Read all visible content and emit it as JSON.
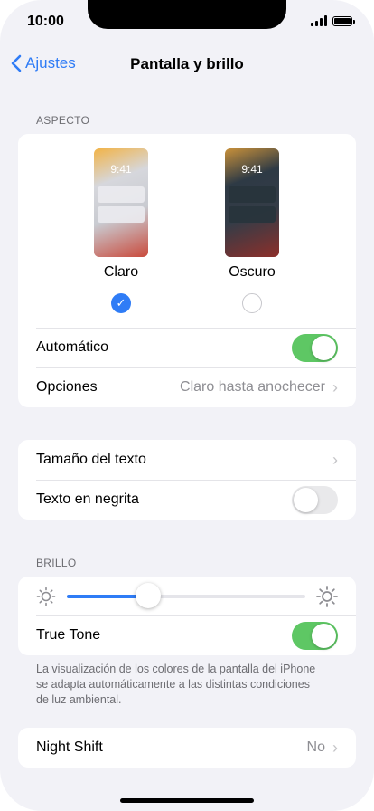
{
  "status": {
    "time": "10:00"
  },
  "nav": {
    "back_label": "Ajustes",
    "title": "Pantalla y brillo"
  },
  "appearance": {
    "header": "ASPECTO",
    "preview_time": "9:41",
    "light_label": "Claro",
    "dark_label": "Oscuro",
    "selected": "Claro"
  },
  "appearance_rows": {
    "automatic_label": "Automático",
    "automatic_on": true,
    "options_label": "Opciones",
    "options_value": "Claro hasta anochecer"
  },
  "text_rows": {
    "text_size_label": "Tamaño del texto",
    "bold_label": "Texto en negrita",
    "bold_on": false
  },
  "brightness": {
    "header": "BRILLO",
    "level": 0.34,
    "true_tone_label": "True Tone",
    "true_tone_on": true,
    "note": "La visualización de los colores de la pantalla del iPhone se adapta automáticamente a las distintas condiciones de luz ambiental."
  },
  "night_shift": {
    "label": "Night Shift",
    "value": "No"
  },
  "colors": {
    "accent": "#2f7cf6",
    "toggle_on": "#5ec764"
  }
}
